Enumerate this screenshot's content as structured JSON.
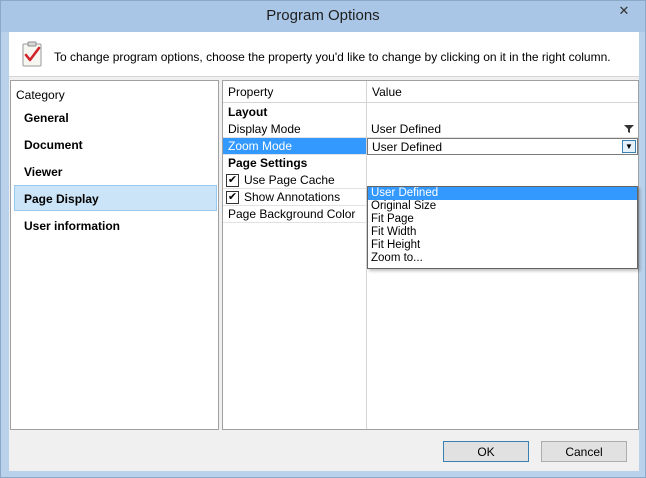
{
  "window": {
    "title": "Program Options",
    "close_glyph": "✕"
  },
  "header": {
    "icon": "clipboard-check-icon",
    "text": "To change program options, choose the property you'd like to change by clicking on it in the right column."
  },
  "category": {
    "title": "Category",
    "items": [
      {
        "label": "General",
        "selected": false
      },
      {
        "label": "Document",
        "selected": false
      },
      {
        "label": "Viewer",
        "selected": false
      },
      {
        "label": "Page Display",
        "selected": true
      },
      {
        "label": "User information",
        "selected": false
      }
    ]
  },
  "grid": {
    "columns": [
      "Property",
      "Value"
    ],
    "groups": {
      "layout": "Layout",
      "page_settings": "Page Settings"
    },
    "rows": {
      "display_mode": {
        "name": "Display Mode",
        "value": "User Defined"
      },
      "zoom_mode": {
        "name": "Zoom Mode",
        "value": "User Defined"
      },
      "use_page_cache": {
        "name": "Use Page Cache",
        "checked": true
      },
      "show_annotations": {
        "name": "Show Annotations",
        "checked": true
      },
      "page_background_color": {
        "name": "Page Background Color",
        "value": ""
      }
    }
  },
  "zoom_dropdown": {
    "options": [
      "User Defined",
      "Original Size",
      "Fit Page",
      "Fit Width",
      "Fit Height",
      "Zoom to..."
    ],
    "selected": "User Defined"
  },
  "buttons": {
    "ok": "OK",
    "cancel": "Cancel"
  },
  "colors": {
    "selection": "#3399ff",
    "category_selected": "#cce4f7",
    "window_frame": "#a9c6e6"
  }
}
